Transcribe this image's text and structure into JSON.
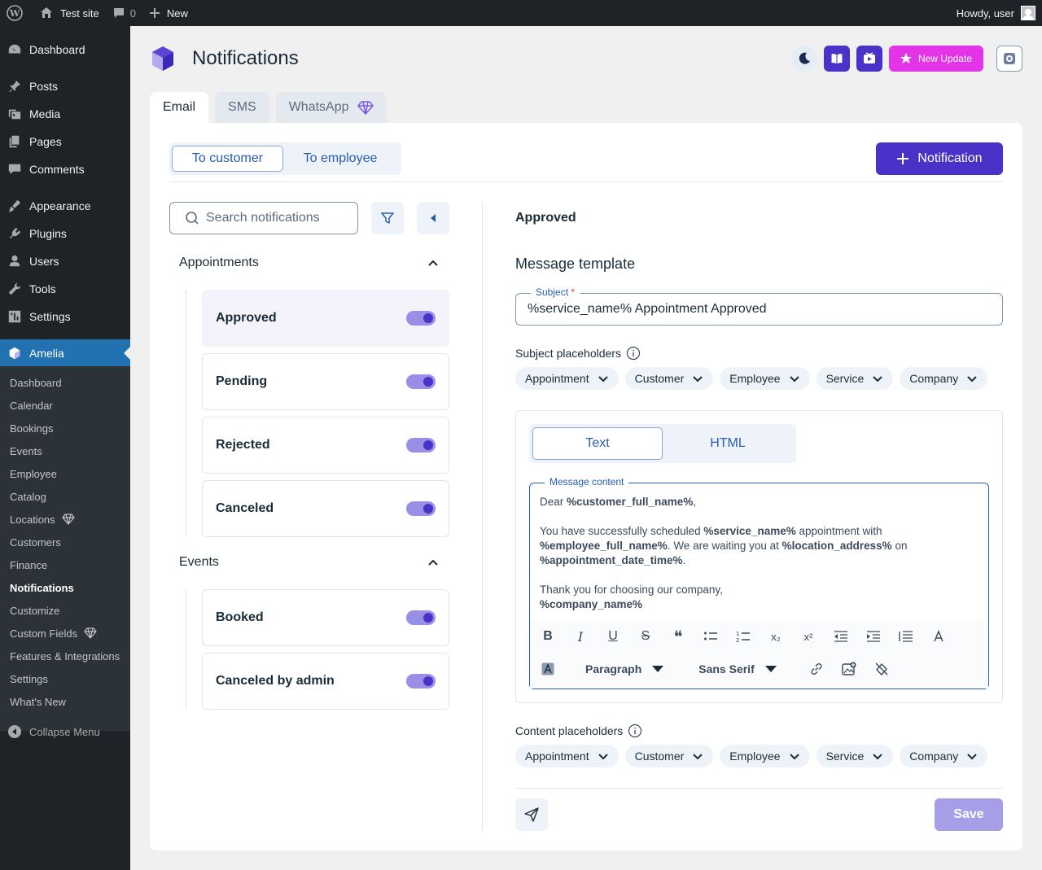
{
  "adminbar": {
    "site_name": "Test site",
    "comments_count": "0",
    "new_label": "New",
    "howdy": "Howdy, user"
  },
  "sidebar": {
    "items": [
      {
        "label": "Dashboard",
        "icon": "dashboard-icon"
      },
      {
        "label": "Posts",
        "icon": "pin-icon"
      },
      {
        "label": "Media",
        "icon": "media-icon"
      },
      {
        "label": "Pages",
        "icon": "pages-icon"
      },
      {
        "label": "Comments",
        "icon": "comment-icon"
      },
      {
        "label": "Appearance",
        "icon": "brush-icon"
      },
      {
        "label": "Plugins",
        "icon": "plugin-icon"
      },
      {
        "label": "Users",
        "icon": "user-icon"
      },
      {
        "label": "Tools",
        "icon": "wrench-icon"
      },
      {
        "label": "Settings",
        "icon": "settings-icon"
      },
      {
        "label": "Amelia",
        "icon": "amelia-icon"
      }
    ],
    "submenu": [
      "Dashboard",
      "Calendar",
      "Bookings",
      "Events",
      "Employee",
      "Catalog",
      "Locations",
      "Customers",
      "Finance",
      "Notifications",
      "Customize",
      "Custom Fields",
      "Features & Integrations",
      "Settings",
      "What's New"
    ],
    "collapse_label": "Collapse Menu"
  },
  "header": {
    "title": "Notifications",
    "new_update_label": "New Update"
  },
  "tabs": [
    {
      "label": "Email"
    },
    {
      "label": "SMS"
    },
    {
      "label": "WhatsApp"
    }
  ],
  "recipient": {
    "customer_label": "To customer",
    "employee_label": "To employee",
    "add_label": "Notification"
  },
  "search": {
    "placeholder": "Search notifications"
  },
  "groups": [
    {
      "label": "Appointments",
      "items": [
        "Approved",
        "Pending",
        "Rejected",
        "Canceled"
      ]
    },
    {
      "label": "Events",
      "items": [
        "Booked",
        "Canceled by admin"
      ]
    }
  ],
  "detail": {
    "title": "Approved",
    "section_title": "Message template",
    "subject_label": "Subject",
    "subject_required": "*",
    "subject_value": "%service_name% Appointment Approved",
    "subject_placeholders_label": "Subject placeholders",
    "content_placeholders_label": "Content placeholders",
    "placeholder_chips": [
      "Appointment",
      "Customer",
      "Employee",
      "Service",
      "Company"
    ],
    "mode_text": "Text",
    "mode_html": "HTML",
    "message_label": "Message content",
    "message": {
      "l1a": "Dear ",
      "l1b": "%customer_full_name%",
      "l1c": ",",
      "l2a": "You have successfully scheduled ",
      "l2b": "%service_name%",
      "l2c": " appointment with",
      "l3a": "%employee_full_name%",
      "l3b": ". We are waiting you at ",
      "l3c": "%location_address%",
      "l3d": " on",
      "l4a": "%appointment_date_time%",
      "l4b": ".",
      "l5": "Thank you for choosing our company,",
      "l6": "%company_name%"
    },
    "toolbar": {
      "bold": "B",
      "italic": "I",
      "underline": "U",
      "strike": "S",
      "quote": "❝",
      "sub": "x₂",
      "sup": "x²",
      "paragraph": "Paragraph",
      "font": "Sans Serif"
    },
    "save_label": "Save"
  },
  "colors": {
    "primary": "#4a32c8",
    "wp_blue": "#2271b1",
    "new_update": "#e434e8"
  }
}
